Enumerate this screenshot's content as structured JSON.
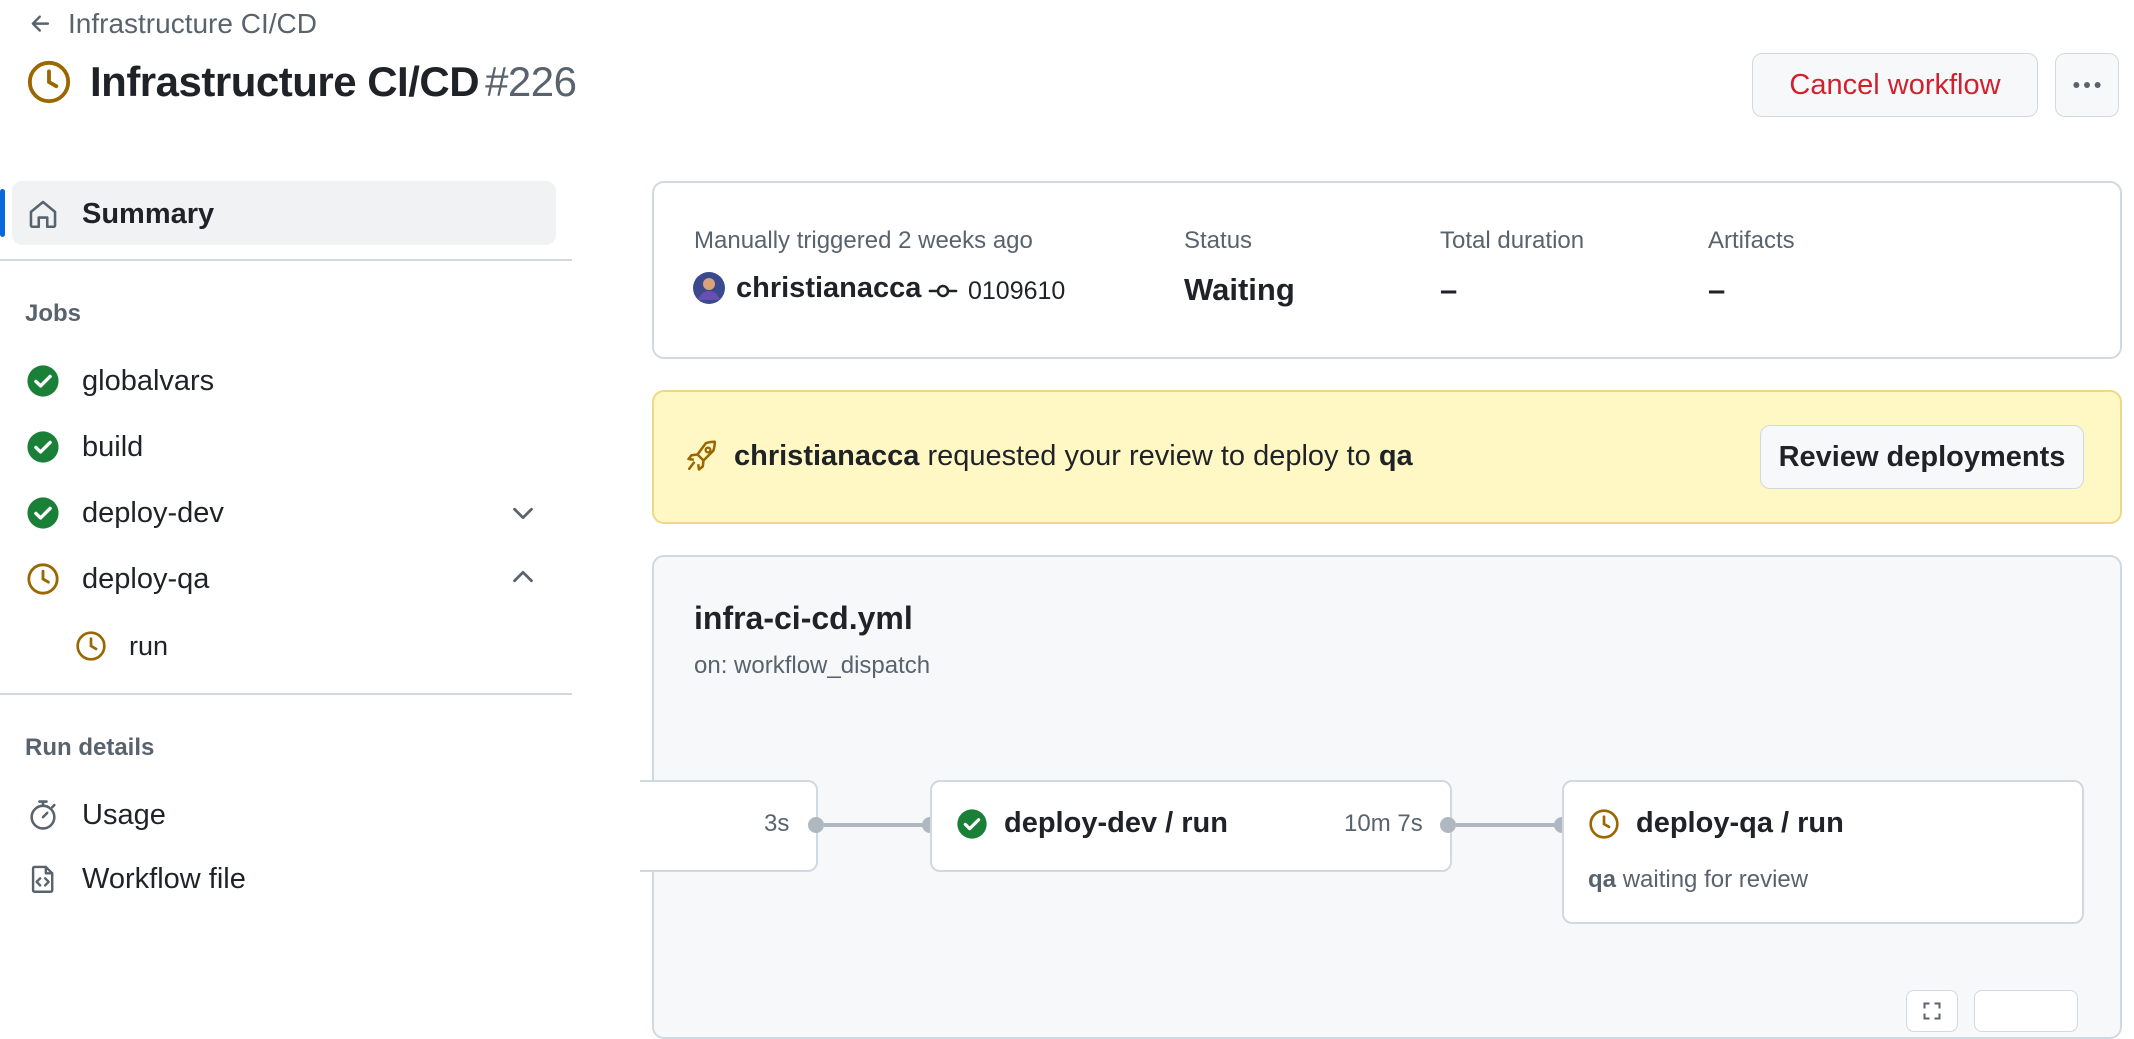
{
  "header": {
    "back_label": "Infrastructure CI/CD",
    "title": "Infrastructure CI/CD",
    "run_number": "#226",
    "cancel_label": "Cancel workflow",
    "more_icon": "kebab-horizontal-icon"
  },
  "sidebar": {
    "summary_label": "Summary",
    "jobs_heading": "Jobs",
    "jobs": [
      {
        "label": "globalvars",
        "status": "success"
      },
      {
        "label": "build",
        "status": "success"
      },
      {
        "label": "deploy-dev",
        "status": "success"
      },
      {
        "label": "deploy-qa",
        "status": "waiting"
      }
    ],
    "subjob_label": "run",
    "run_details_heading": "Run details",
    "usage_label": "Usage",
    "workflow_file_label": "Workflow file"
  },
  "summary": {
    "trigger_label": "Manually triggered 2 weeks ago",
    "actor": "christianacca",
    "commit": "0109610",
    "status_label": "Status",
    "status_value": "Waiting",
    "duration_label": "Total duration",
    "duration_value": "–",
    "artifacts_label": "Artifacts",
    "artifacts_value": "–"
  },
  "review": {
    "actor": "christianacca",
    "text": "requested your review to deploy to",
    "environment": "qa",
    "button_label": "Review deployments"
  },
  "graph": {
    "filename": "infra-ci-cd.yml",
    "trigger": "on: workflow_dispatch",
    "prev_duration": "3s",
    "node1_label": "deploy-dev / run",
    "node1_duration": "10m 7s",
    "node2_label": "deploy-qa / run",
    "node2_env": "qa",
    "node2_status": "waiting for review"
  },
  "colors": {
    "success": "#1a7f37",
    "waiting": "#9a6700",
    "danger": "#cf222e",
    "accent": "#0969da",
    "banner_bg": "#fff8c5"
  }
}
